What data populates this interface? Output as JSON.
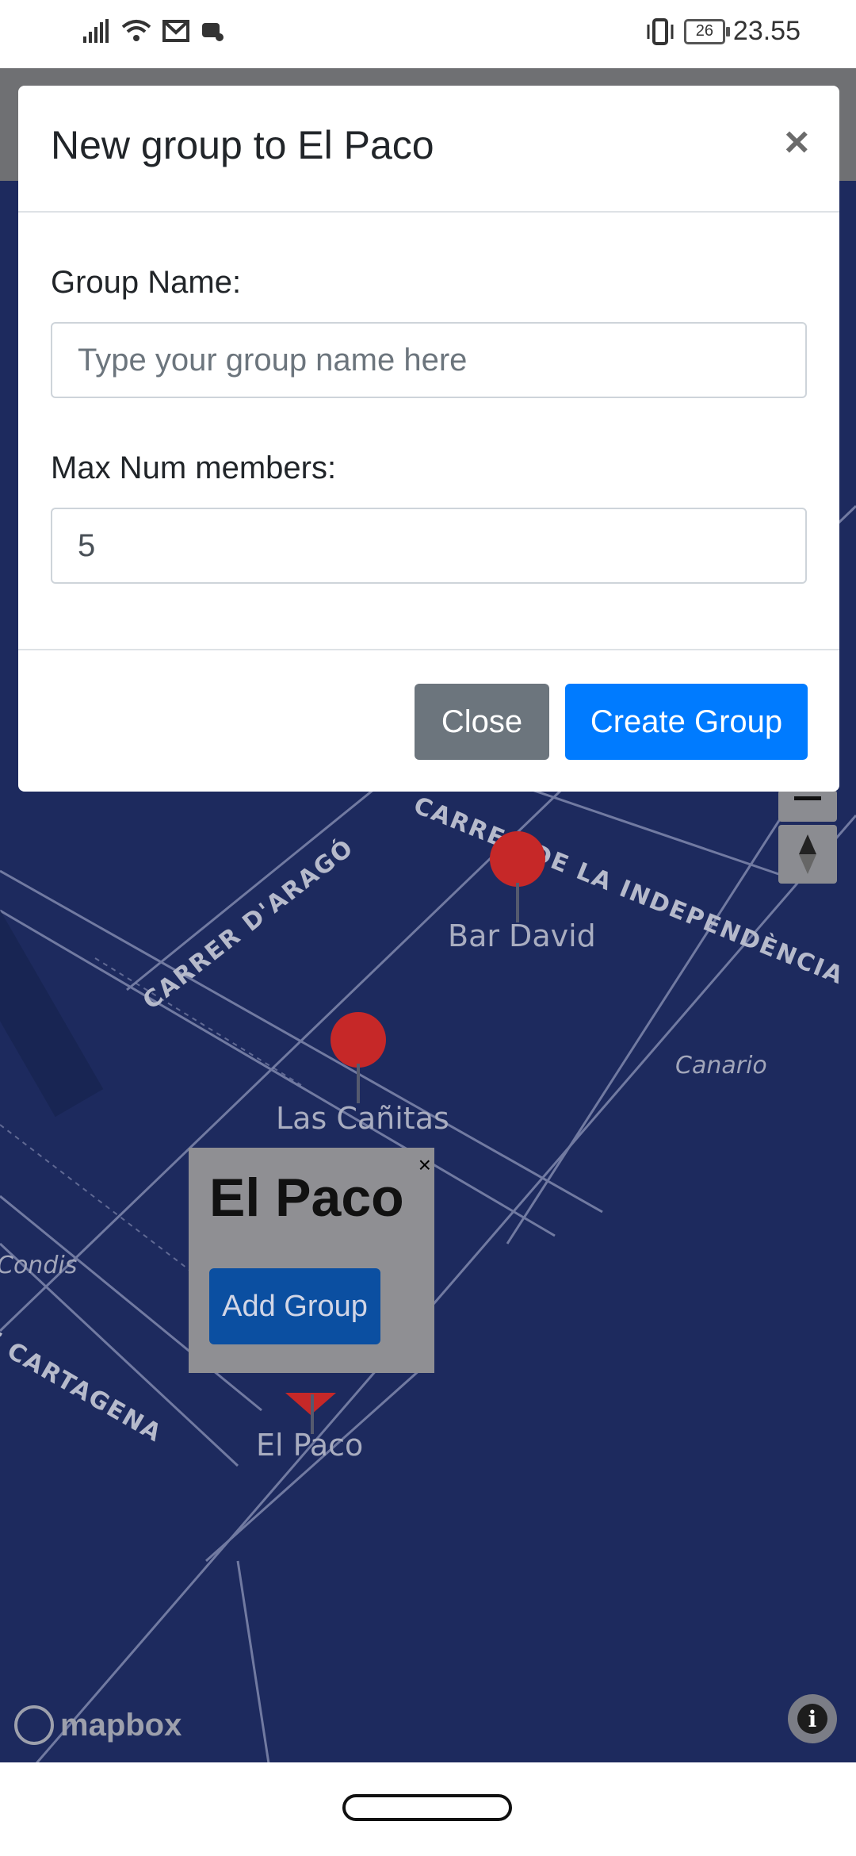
{
  "status_bar": {
    "time": "23.55",
    "battery": "26",
    "icons": [
      "signal-icon",
      "wifi-icon",
      "mail-icon",
      "game-icon",
      "vibrate-icon",
      "battery-icon"
    ]
  },
  "modal": {
    "title": "New group to El Paco",
    "close_symbol": "×",
    "group_name_label": "Group Name:",
    "group_name_placeholder": "Type your group name here",
    "group_name_value": "",
    "max_members_label": "Max Num members:",
    "max_members_value": "5",
    "close_button": "Close",
    "create_button": "Create Group"
  },
  "map": {
    "places": [
      "Bar David",
      "Las Cañitas",
      "El Paco"
    ],
    "streets": [
      "CARRER D'ARAGÓ",
      "CARRER DE LA INDEPENDÈNCIA",
      "E CARTAGENA"
    ],
    "pois": [
      "Canario",
      "Condis"
    ],
    "popup": {
      "title": "El Paco",
      "close_symbol": "×",
      "button": "Add Group"
    },
    "attribution": "mapbox",
    "colors": {
      "water": "#1d2a5e",
      "pin": "#c62828",
      "popup_button": "#0b4fa1"
    }
  }
}
